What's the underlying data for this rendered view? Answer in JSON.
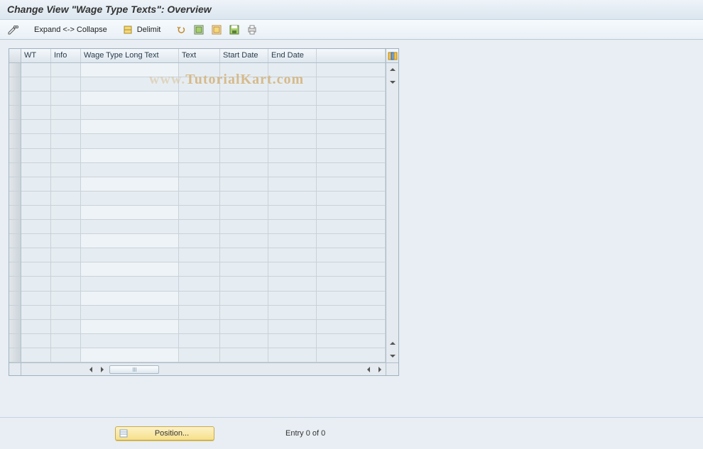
{
  "title": "Change View \"Wage Type Texts\": Overview",
  "toolbar": {
    "expand_collapse": "Expand <-> Collapse",
    "delimit": "Delimit"
  },
  "grid": {
    "columns": {
      "wt": "WT",
      "info": "Info",
      "long": "Wage Type Long Text",
      "text": "Text",
      "start": "Start Date",
      "end": "End Date"
    },
    "visible_rows": 21,
    "rows": []
  },
  "footer": {
    "position_btn": "Position...",
    "entry_status": "Entry 0 of 0"
  },
  "watermark": {
    "left": "www.",
    "right": "TutorialKart.com"
  }
}
